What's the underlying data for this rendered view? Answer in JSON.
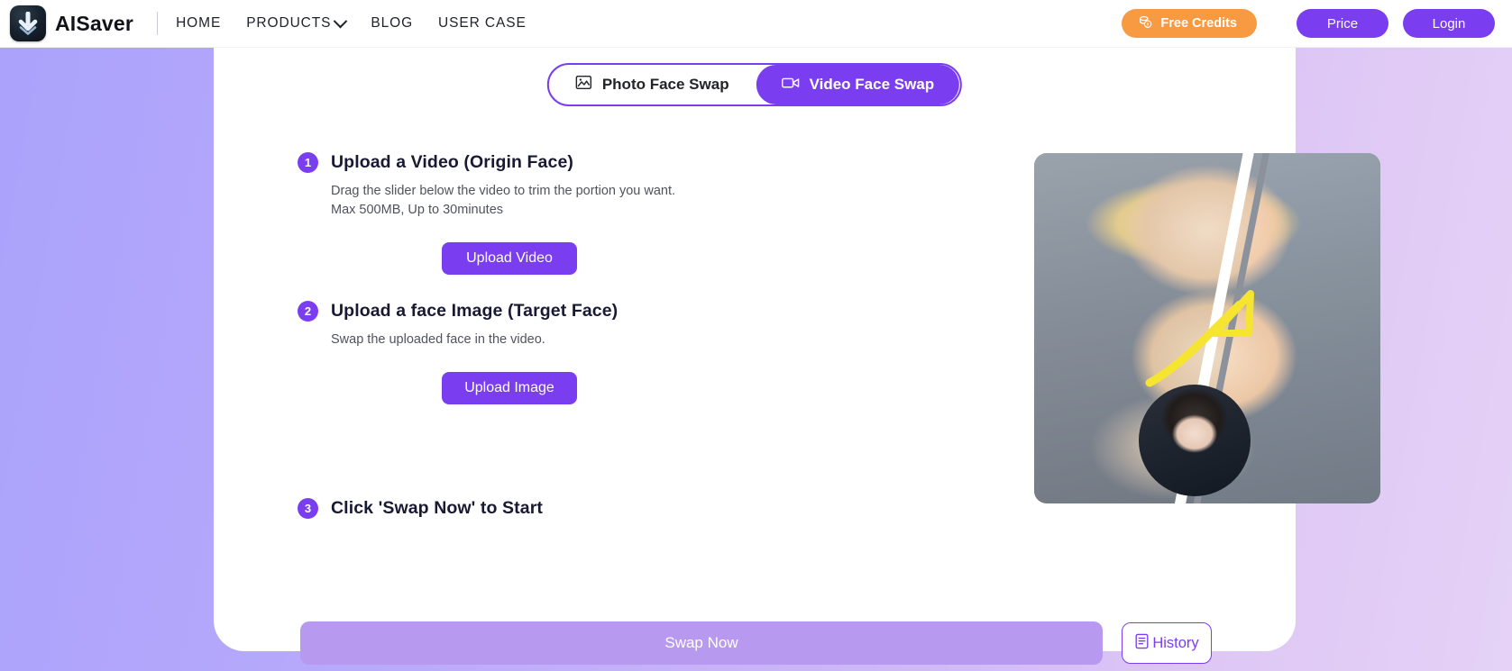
{
  "header": {
    "brand": "AISaver",
    "logo_icon": "download-arrow-logo-icon",
    "nav": [
      {
        "label": "HOME",
        "has_caret": false
      },
      {
        "label": "PRODUCTS",
        "has_caret": true
      },
      {
        "label": "BLOG",
        "has_caret": false
      },
      {
        "label": "USER CASE",
        "has_caret": false
      }
    ],
    "free_credits_label": "Free Credits",
    "free_credits_icon": "coins-icon",
    "free_credits_color": "#f89a42",
    "price_label": "Price",
    "login_label": "Login",
    "accent_color": "#7a3ef0"
  },
  "tabs": [
    {
      "label": "Photo Face Swap",
      "icon": "image-icon",
      "active": false
    },
    {
      "label": "Video Face Swap",
      "icon": "video-camera-icon",
      "active": true
    }
  ],
  "steps": [
    {
      "number": "1",
      "title": "Upload a Video (Origin Face)",
      "desc_line1": "Drag the slider below the video to trim the portion you want.",
      "desc_line2": "Max 500MB, Up to 30minutes",
      "button": "Upload Video"
    },
    {
      "number": "2",
      "title": "Upload a face Image (Target Face)",
      "desc_line1": "Swap the uploaded face in the video.",
      "desc_line2": "",
      "button": "Upload Image"
    },
    {
      "number": "3",
      "title": "Click 'Swap Now' to Start",
      "desc_line1": "",
      "desc_line2": "",
      "button": ""
    }
  ],
  "preview": {
    "alt": "before-after-face-swap-preview",
    "arrow_color": "#f5e531"
  },
  "actions": {
    "swap_label": "Swap Now",
    "swap_disabled_color": "#b79af0",
    "history_label": "History",
    "history_icon": "document-list-icon"
  }
}
